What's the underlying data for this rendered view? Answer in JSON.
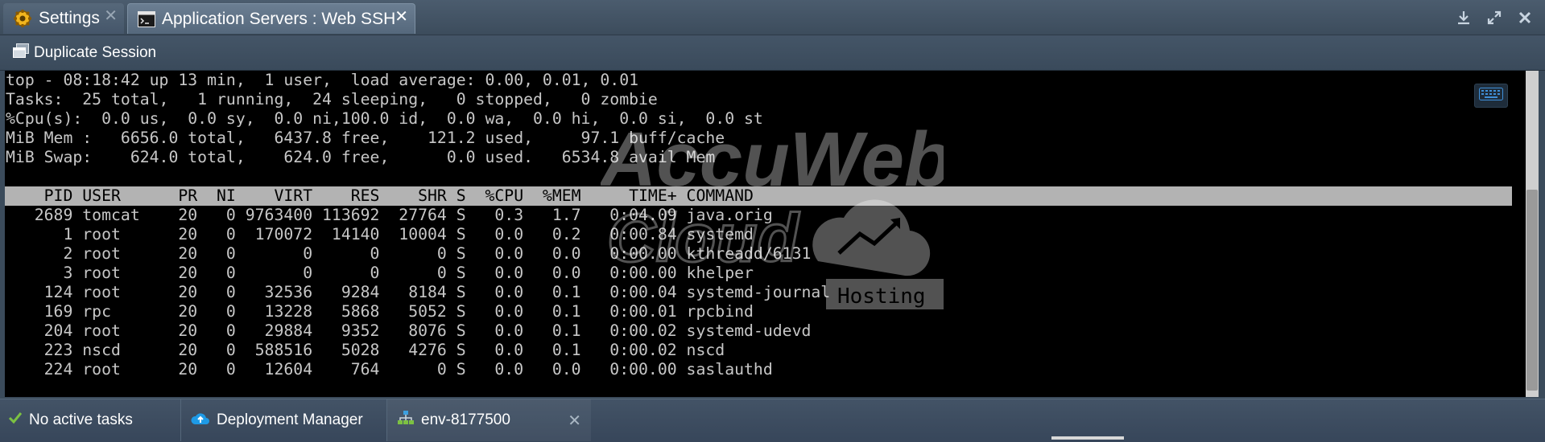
{
  "tabs": [
    {
      "label": "Settings",
      "close": "✕"
    },
    {
      "label": "Application Servers : Web SSH",
      "close": "✕"
    }
  ],
  "window_controls": {
    "download": "download-icon",
    "expand": "expand-icon",
    "close": "close-icon"
  },
  "toolbar": {
    "duplicate_label": "Duplicate Session"
  },
  "terminal": {
    "summary": [
      "top - 08:18:42 up 13 min,  1 user,  load average: 0.00, 0.01, 0.01",
      "Tasks:  25 total,   1 running,  24 sleeping,   0 stopped,   0 zombie",
      "%Cpu(s):  0.0 us,  0.0 sy,  0.0 ni,100.0 id,  0.0 wa,  0.0 hi,  0.0 si,  0.0 st",
      "MiB Mem :   6656.0 total,   6437.8 free,    121.2 used,     97.1 buff/cache",
      "MiB Swap:    624.0 total,    624.0 free,      0.0 used.   6534.8 avail Mem"
    ],
    "header": "    PID USER      PR  NI    VIRT    RES    SHR S  %CPU  %MEM     TIME+ COMMAND",
    "rows": [
      "   2689 tomcat    20   0 9763400 113692  27764 S   0.3   1.7   0:04.09 java.orig",
      "      1 root      20   0  170072  14140  10004 S   0.0   0.2   0:00.84 systemd",
      "      2 root      20   0       0      0      0 S   0.0   0.0   0:00.00 kthreadd/6131",
      "      3 root      20   0       0      0      0 S   0.0   0.0   0:00.00 khelper",
      "    124 root      20   0   32536   9284   8184 S   0.0   0.1   0:00.04 systemd-journal",
      "    169 rpc       20   0   13228   5868   5052 S   0.0   0.1   0:00.01 rpcbind",
      "    204 root      20   0   29884   9352   8076 S   0.0   0.1   0:00.02 systemd-udevd",
      "    223 nscd      20   0  588516   5028   4276 S   0.0   0.1   0:00.02 nscd",
      "    224 root      20   0   12604    764      0 S   0.0   0.0   0:00.00 saslauthd"
    ]
  },
  "watermark": {
    "brand_top": "AccuWeb",
    "brand_mid": "Cloud",
    "brand_tag": "Hosting"
  },
  "statusbar": {
    "tasks_label": "No active tasks",
    "deploy_label": "Deployment Manager",
    "env_label": "env-8177500",
    "env_close": "✕"
  },
  "colors": {
    "accent": "#3b4b5b",
    "terminal_bg": "#000000",
    "terminal_fg": "#c7c7c7",
    "header_bg": "#b3b3b3",
    "ok_green": "#7cc142"
  }
}
